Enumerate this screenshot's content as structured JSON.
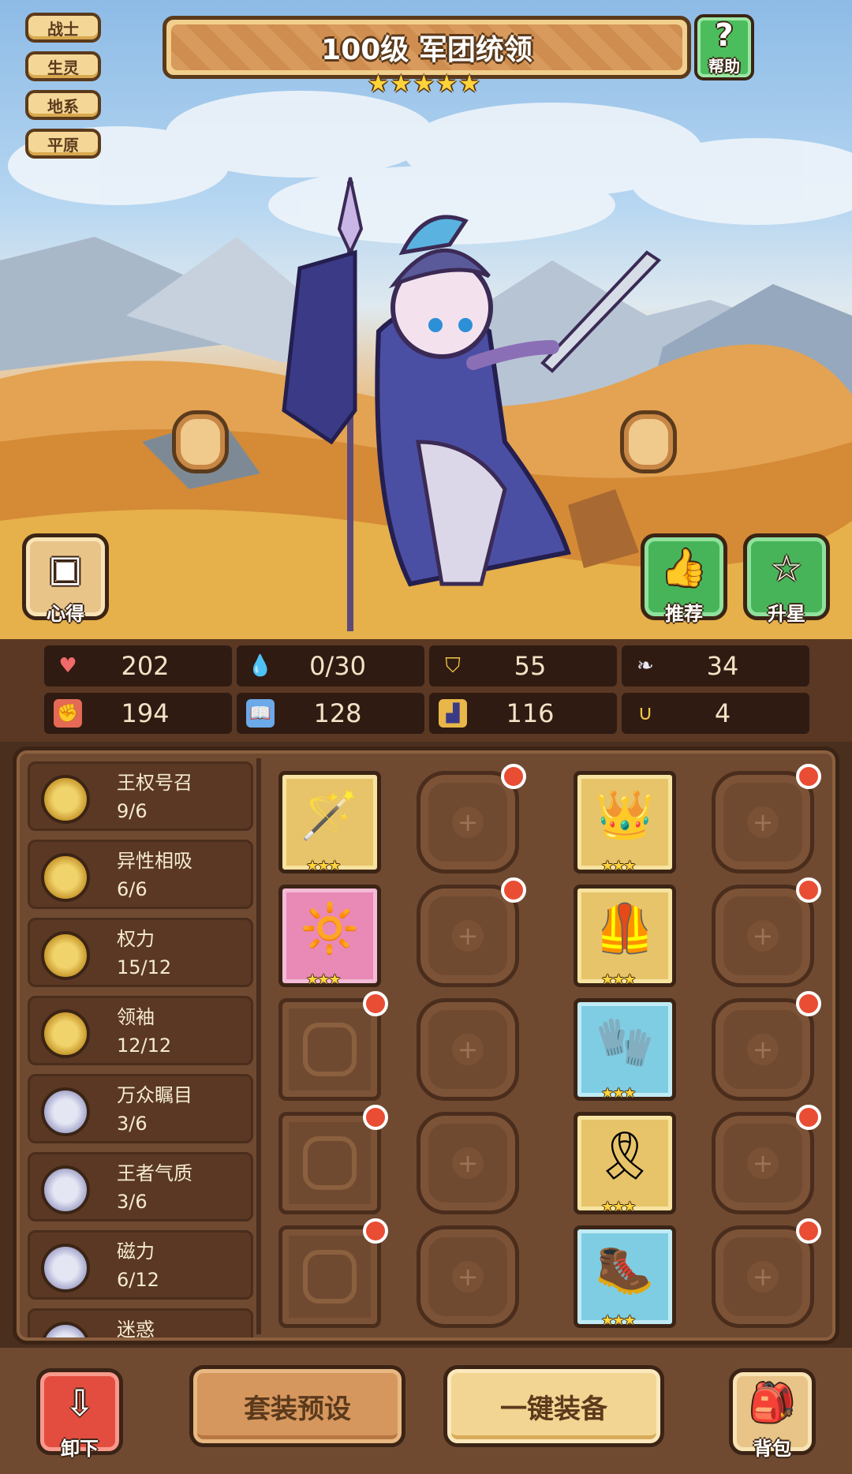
{
  "tags": [
    "战士",
    "生灵",
    "地系",
    "平原"
  ],
  "title": "100级 军团统领",
  "star_count": 5,
  "help_label": "帮助",
  "buttons": {
    "insight": "心得",
    "recommend": "推荐",
    "star_up": "升星",
    "unequip": "卸下",
    "preset": "套装预设",
    "equip_all": "一键装备",
    "bag": "背包"
  },
  "stats": [
    {
      "icon": "heart-icon",
      "value": "202"
    },
    {
      "icon": "drop-icon",
      "value": "0/30"
    },
    {
      "icon": "shield-icon",
      "value": "55"
    },
    {
      "icon": "wing-icon",
      "value": "34"
    },
    {
      "icon": "fist-icon",
      "value": "194"
    },
    {
      "icon": "book-icon",
      "value": "128"
    },
    {
      "icon": "boot-icon",
      "value": "116"
    },
    {
      "icon": "horseshoe-icon",
      "value": "4"
    }
  ],
  "sets": [
    {
      "name": "王权号召",
      "count": "9/6",
      "tier": "gold"
    },
    {
      "name": "异性相吸",
      "count": "6/6",
      "tier": "gold"
    },
    {
      "name": "权力",
      "count": "15/12",
      "tier": "gold"
    },
    {
      "name": "领袖",
      "count": "12/12",
      "tier": "gold"
    },
    {
      "name": "万众瞩目",
      "count": "3/6",
      "tier": "silver"
    },
    {
      "name": "王者气质",
      "count": "3/6",
      "tier": "silver"
    },
    {
      "name": "磁力",
      "count": "6/12",
      "tier": "silver"
    },
    {
      "name": "迷惑",
      "count": "",
      "tier": "silver"
    }
  ],
  "colors": {
    "panel": "#6f4a31",
    "accent_green": "#47b45a",
    "accent_red": "#e34d3f",
    "notification": "#e94d33"
  }
}
